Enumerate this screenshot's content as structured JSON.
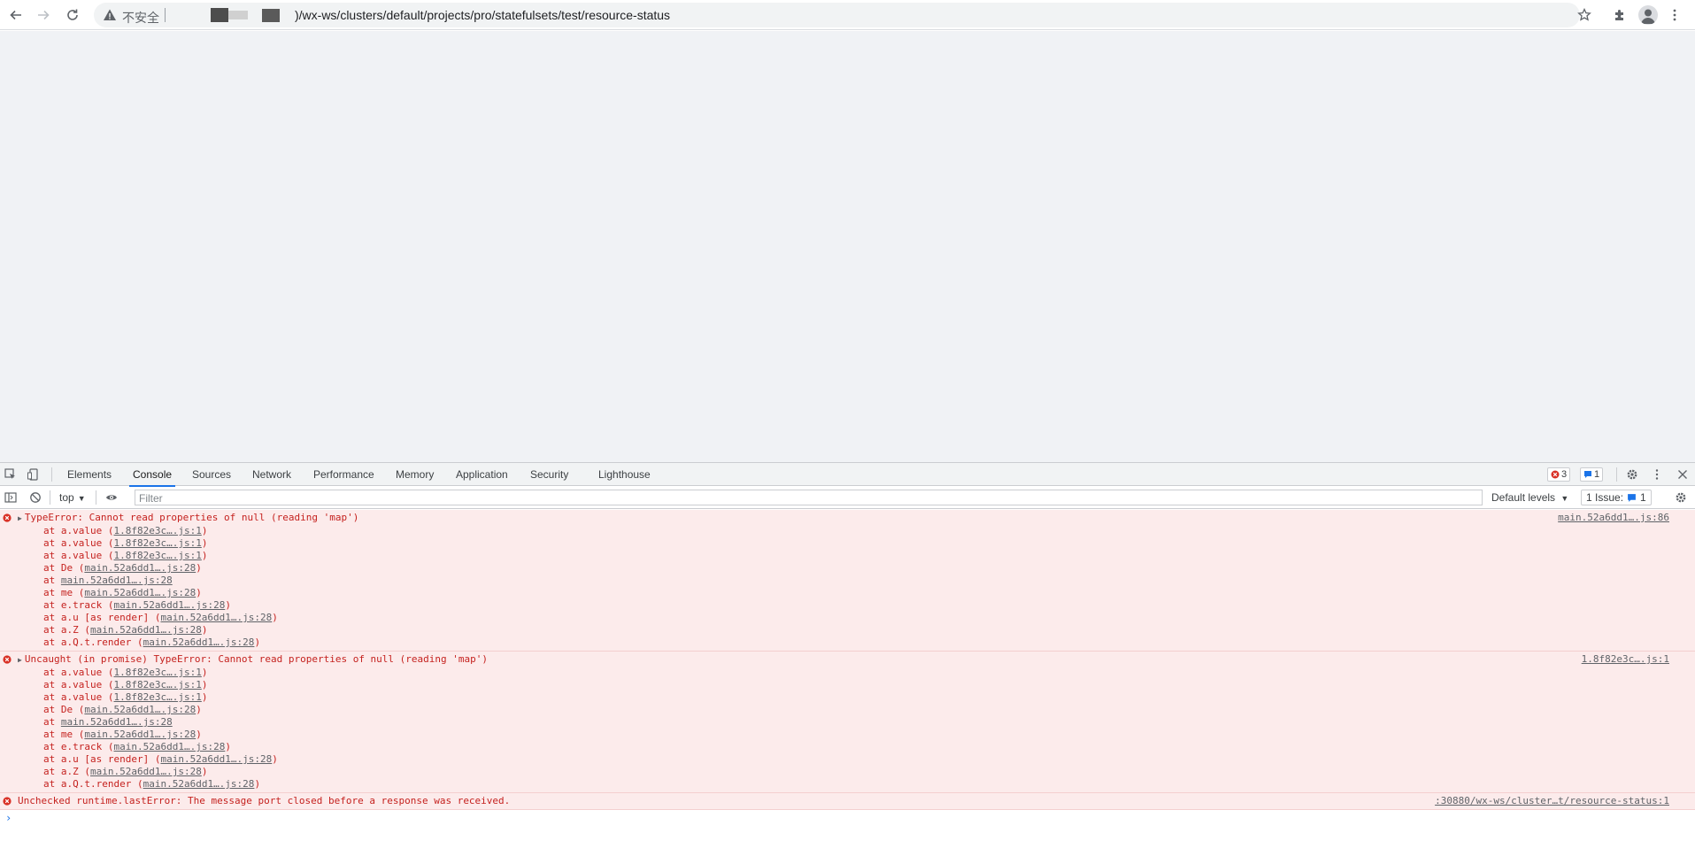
{
  "browser": {
    "insecure_label": "不安全",
    "url_tail": ")/wx-ws/clusters/default/projects/pro/statefulsets/test/resource-status"
  },
  "devtools": {
    "tabs": [
      "Elements",
      "Console",
      "Sources",
      "Network",
      "Performance",
      "Memory",
      "Application",
      "Security",
      "Lighthouse"
    ],
    "active_tab": "Console",
    "error_count": "3",
    "info_count": "1",
    "context": "top",
    "filter_placeholder": "Filter",
    "levels_label": "Default levels",
    "issues_label": "1 Issue:",
    "issues_count": "1"
  },
  "console": {
    "messages": [
      {
        "text": "TypeError: Cannot read properties of null (reading 'map')",
        "source": "main.52a6dd1….js:86",
        "frames": [
          {
            "prefix": "at a.value (",
            "link": "1.8f82e3c….js:1",
            "suffix": ")"
          },
          {
            "prefix": "at a.value (",
            "link": "1.8f82e3c….js:1",
            "suffix": ")"
          },
          {
            "prefix": "at a.value (",
            "link": "1.8f82e3c….js:1",
            "suffix": ")"
          },
          {
            "prefix": "at De (",
            "link": "main.52a6dd1….js:28",
            "suffix": ")"
          },
          {
            "prefix": "at ",
            "link": "main.52a6dd1….js:28",
            "suffix": ""
          },
          {
            "prefix": "at me (",
            "link": "main.52a6dd1….js:28",
            "suffix": ")"
          },
          {
            "prefix": "at e.track (",
            "link": "main.52a6dd1….js:28",
            "suffix": ")"
          },
          {
            "prefix": "at a.u [as render] (",
            "link": "main.52a6dd1….js:28",
            "suffix": ")"
          },
          {
            "prefix": "at a.Z (",
            "link": "main.52a6dd1….js:28",
            "suffix": ")"
          },
          {
            "prefix": "at a.Q.t.render (",
            "link": "main.52a6dd1….js:28",
            "suffix": ")"
          }
        ]
      },
      {
        "text": "Uncaught (in promise) TypeError: Cannot read properties of null (reading 'map')",
        "source": "1.8f82e3c….js:1",
        "frames": [
          {
            "prefix": "at a.value (",
            "link": "1.8f82e3c….js:1",
            "suffix": ")"
          },
          {
            "prefix": "at a.value (",
            "link": "1.8f82e3c….js:1",
            "suffix": ")"
          },
          {
            "prefix": "at a.value (",
            "link": "1.8f82e3c….js:1",
            "suffix": ")"
          },
          {
            "prefix": "at De (",
            "link": "main.52a6dd1….js:28",
            "suffix": ")"
          },
          {
            "prefix": "at ",
            "link": "main.52a6dd1….js:28",
            "suffix": ""
          },
          {
            "prefix": "at me (",
            "link": "main.52a6dd1….js:28",
            "suffix": ")"
          },
          {
            "prefix": "at e.track (",
            "link": "main.52a6dd1….js:28",
            "suffix": ")"
          },
          {
            "prefix": "at a.u [as render] (",
            "link": "main.52a6dd1….js:28",
            "suffix": ")"
          },
          {
            "prefix": "at a.Z (",
            "link": "main.52a6dd1….js:28",
            "suffix": ")"
          },
          {
            "prefix": "at a.Q.t.render (",
            "link": "main.52a6dd1….js:28",
            "suffix": ")"
          }
        ]
      },
      {
        "text": "Unchecked runtime.lastError: The message port closed before a response was received.",
        "source": ":30880/wx-ws/cluster…t/resource-status:1",
        "frames": []
      }
    ],
    "prompt_symbol": "›"
  }
}
